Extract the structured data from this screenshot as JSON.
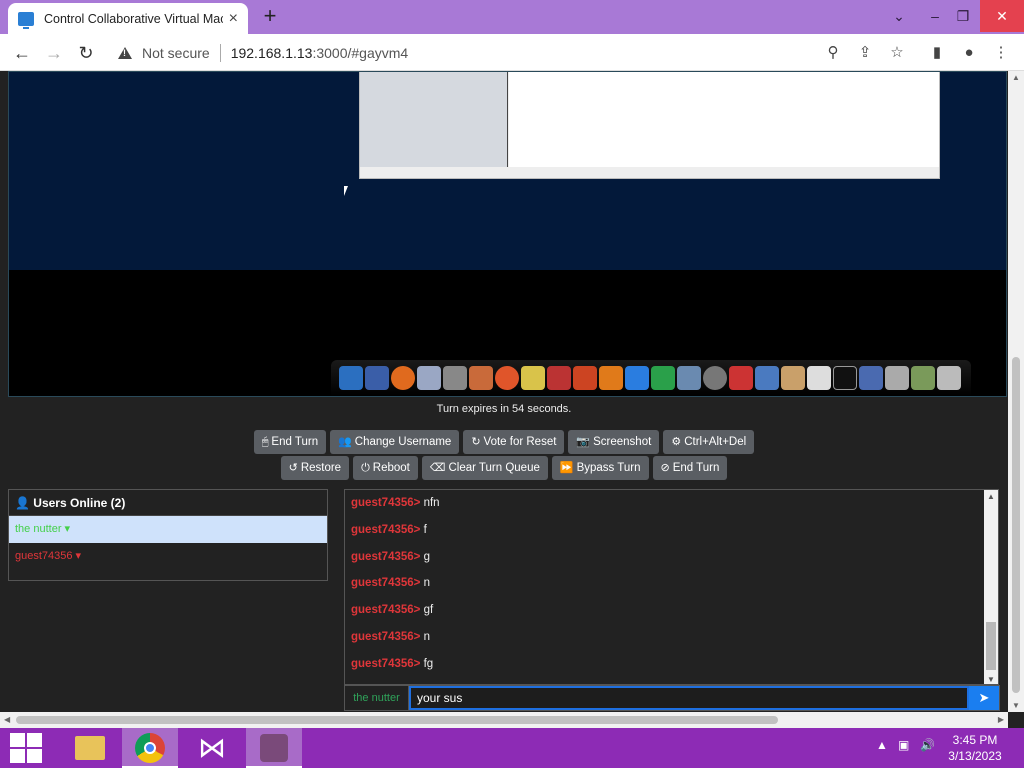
{
  "browser": {
    "tab_title": "Control Collaborative Virtual Mac",
    "security_label": "Not secure",
    "url_host": "192.168.1.13",
    "url_rest": ":3000/#gayvm4"
  },
  "vm": {
    "turn_info": "Turn expires in 54 seconds."
  },
  "buttons": {
    "row1": [
      {
        "icon": "🖱",
        "label": "End Turn"
      },
      {
        "icon": "👥",
        "label": "Change Username"
      },
      {
        "icon": "↻",
        "label": "Vote for Reset"
      },
      {
        "icon": "📷",
        "label": "Screenshot"
      },
      {
        "icon": "⚙",
        "label": "Ctrl+Alt+Del"
      }
    ],
    "row2": [
      {
        "icon": "↺",
        "label": "Restore"
      },
      {
        "icon": "⏻",
        "label": "Reboot"
      },
      {
        "icon": "⌫",
        "label": "Clear Turn Queue"
      },
      {
        "icon": "⏩",
        "label": "Bypass Turn"
      },
      {
        "icon": "⊘",
        "label": "End Turn"
      }
    ]
  },
  "users": {
    "header": "Users Online (2)",
    "list": [
      {
        "name": "the nutter ▾",
        "state": "active"
      },
      {
        "name": "guest74356 ▾",
        "state": "guest"
      }
    ]
  },
  "chat": {
    "messages": [
      {
        "user": "guest74356>",
        "text": "nfn"
      },
      {
        "user": "guest74356>",
        "text": "f"
      },
      {
        "user": "guest74356>",
        "text": "g"
      },
      {
        "user": "guest74356>",
        "text": "n"
      },
      {
        "user": "guest74356>",
        "text": "gf"
      },
      {
        "user": "guest74356>",
        "text": "n"
      },
      {
        "user": "guest74356>",
        "text": "fg"
      }
    ],
    "username": "the nutter",
    "input_value": "your sus"
  },
  "taskbar": {
    "time": "3:45 PM",
    "date": "3/13/2023"
  },
  "colors": {
    "tabbar": "#a879d6",
    "taskbar": "#8d2bb5",
    "guest_name": "#e0363a",
    "active_user": "#44d04a",
    "send_button": "#1a7ef0"
  }
}
